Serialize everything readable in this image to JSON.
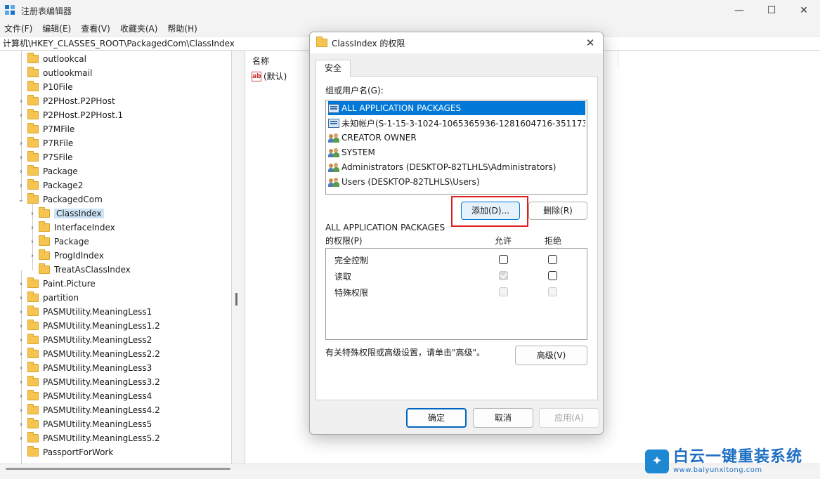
{
  "window": {
    "title": "注册表编辑器",
    "minimize": "—",
    "maximize": "☐",
    "close": "✕"
  },
  "menu": [
    "文件(F)",
    "编辑(E)",
    "查看(V)",
    "收藏夹(A)",
    "帮助(H)"
  ],
  "address": "计算机\\HKEY_CLASSES_ROOT\\PackagedCom\\ClassIndex",
  "tree": {
    "items": [
      {
        "label": "outlookcal",
        "level": 0,
        "expander": ""
      },
      {
        "label": "outlookmail",
        "level": 0,
        "expander": ""
      },
      {
        "label": "P10File",
        "level": 0,
        "expander": ""
      },
      {
        "label": "P2PHost.P2PHost",
        "level": 0,
        "expander": "›"
      },
      {
        "label": "P2PHost.P2PHost.1",
        "level": 0,
        "expander": "›"
      },
      {
        "label": "P7MFile",
        "level": 0,
        "expander": ""
      },
      {
        "label": "P7RFile",
        "level": 0,
        "expander": "›"
      },
      {
        "label": "P7SFile",
        "level": 0,
        "expander": "›"
      },
      {
        "label": "Package",
        "level": 0,
        "expander": "›"
      },
      {
        "label": "Package2",
        "level": 0,
        "expander": "›"
      },
      {
        "label": "PackagedCom",
        "level": 0,
        "expander": "⌄"
      },
      {
        "label": "ClassIndex",
        "level": 1,
        "expander": "›",
        "selected": true
      },
      {
        "label": "InterfaceIndex",
        "level": 1,
        "expander": "›"
      },
      {
        "label": "Package",
        "level": 1,
        "expander": "›"
      },
      {
        "label": "ProgIdIndex",
        "level": 1,
        "expander": "›"
      },
      {
        "label": "TreatAsClassIndex",
        "level": 1,
        "expander": ""
      },
      {
        "label": "Paint.Picture",
        "level": 0,
        "expander": "›"
      },
      {
        "label": "partition",
        "level": 0,
        "expander": "›"
      },
      {
        "label": "PASMUtility.MeaningLess1",
        "level": 0,
        "expander": "›"
      },
      {
        "label": "PASMUtility.MeaningLess1.2",
        "level": 0,
        "expander": "›"
      },
      {
        "label": "PASMUtility.MeaningLess2",
        "level": 0,
        "expander": "›"
      },
      {
        "label": "PASMUtility.MeaningLess2.2",
        "level": 0,
        "expander": "›"
      },
      {
        "label": "PASMUtility.MeaningLess3",
        "level": 0,
        "expander": "›"
      },
      {
        "label": "PASMUtility.MeaningLess3.2",
        "level": 0,
        "expander": "›"
      },
      {
        "label": "PASMUtility.MeaningLess4",
        "level": 0,
        "expander": "›"
      },
      {
        "label": "PASMUtility.MeaningLess4.2",
        "level": 0,
        "expander": "›"
      },
      {
        "label": "PASMUtility.MeaningLess5",
        "level": 0,
        "expander": "›"
      },
      {
        "label": "PASMUtility.MeaningLess5.2",
        "level": 0,
        "expander": "›"
      },
      {
        "label": "PassportForWork",
        "level": 0,
        "expander": ""
      }
    ]
  },
  "values": {
    "col_name": "名称",
    "default_icon": "ab",
    "default_label": "(默认)"
  },
  "dialog": {
    "title": "ClassIndex 的权限",
    "close": "✕",
    "tab": "安全",
    "group_label": "组或用户名(G):",
    "principals": [
      {
        "name": "ALL APPLICATION PACKAGES",
        "icon": "package-icon",
        "selected": true
      },
      {
        "name": "未知帐户(S-1-15-3-1024-1065365936-1281604716-351173...",
        "icon": "package-icon"
      },
      {
        "name": "CREATOR OWNER",
        "icon": "users-icon"
      },
      {
        "name": "SYSTEM",
        "icon": "users-icon"
      },
      {
        "name": "Administrators (DESKTOP-82TLHLS\\Administrators)",
        "icon": "users-icon"
      },
      {
        "name": "Users (DESKTOP-82TLHLS\\Users)",
        "icon": "users-icon"
      }
    ],
    "add_button": "添加(D)...",
    "remove_button": "删除(R)",
    "perm_for": "ALL APPLICATION PACKAGES",
    "perm_label": "的权限(P)",
    "allow": "允许",
    "deny": "拒绝",
    "permissions": [
      {
        "name": "完全控制",
        "allow": false,
        "allow_enabled": true,
        "deny": false,
        "deny_enabled": true
      },
      {
        "name": "读取",
        "allow": true,
        "allow_enabled": false,
        "deny": false,
        "deny_enabled": true
      },
      {
        "name": "特殊权限",
        "allow": false,
        "allow_enabled": false,
        "deny": false,
        "deny_enabled": false
      }
    ],
    "advanced_hint": "有关特殊权限或高级设置，请单击\"高级\"。",
    "advanced_button": "高级(V)",
    "ok_button": "确定",
    "cancel_button": "取消",
    "apply_button": "应用(A)"
  },
  "watermark": {
    "cn": "白云一键重装系统",
    "url": "www.baiyunxitong.com"
  },
  "colors": {
    "accent": "#0078d7",
    "highlight_box": "#e02020",
    "folder": "#f5c451"
  }
}
